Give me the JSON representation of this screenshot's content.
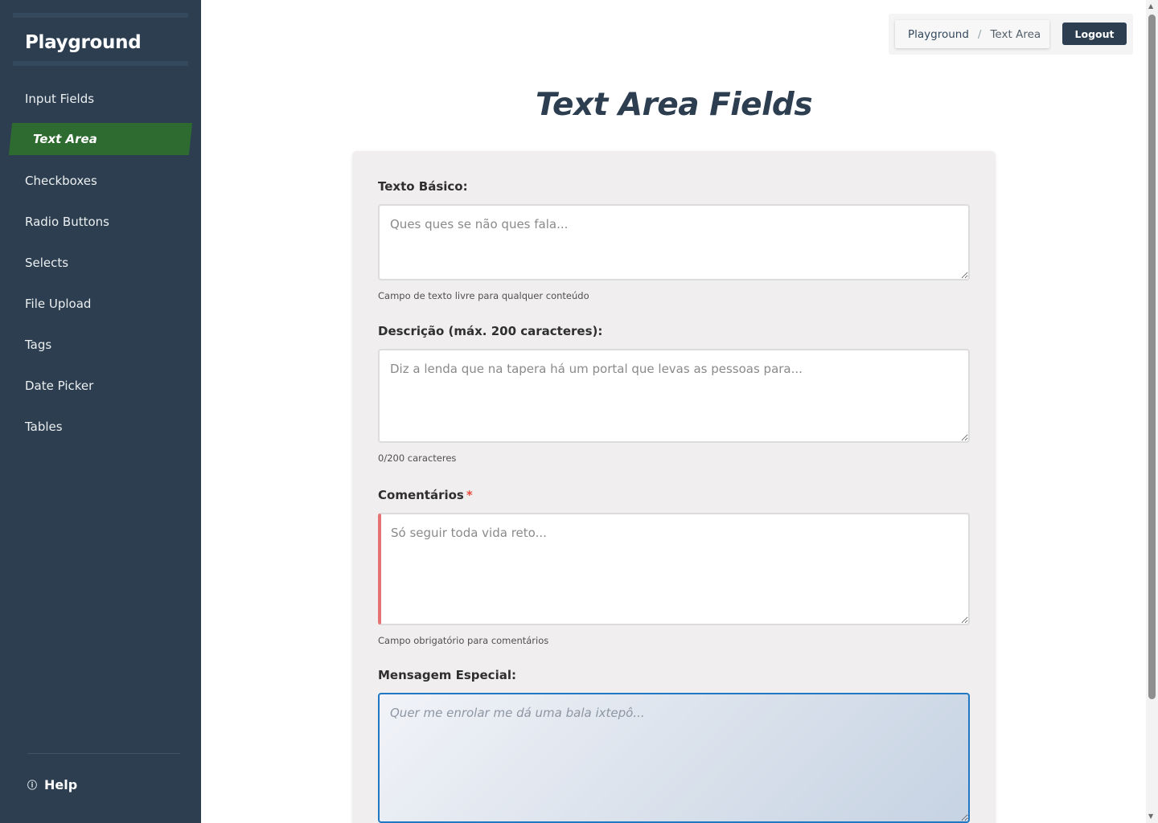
{
  "sidebar": {
    "brand": "Playground",
    "items": [
      {
        "label": "Input Fields"
      },
      {
        "label": "Text Area"
      },
      {
        "label": "Checkboxes"
      },
      {
        "label": "Radio Buttons"
      },
      {
        "label": "Selects"
      },
      {
        "label": "File Upload"
      },
      {
        "label": "Tags"
      },
      {
        "label": "Date Picker"
      },
      {
        "label": "Tables"
      }
    ],
    "active_item": "Text Area",
    "help": {
      "label": "Help",
      "icon": "info-icon"
    }
  },
  "header": {
    "breadcrumb": [
      "Playground",
      "/",
      "Text Area"
    ],
    "logout_label": "Logout"
  },
  "page": {
    "title": "Text Area Fields"
  },
  "form": {
    "fields": [
      {
        "label": "Texto Básico:",
        "placeholder": "Ques ques se não ques fala...",
        "value": "",
        "help": "Campo de texto livre para qualquer conteúdo"
      },
      {
        "label": "Descrição (máx. 200 caracteres):",
        "placeholder": "Diz a lenda que na tapera há um portal que levas as pessoas para...",
        "value": "",
        "help": "0/200 caracteres"
      },
      {
        "label": "Comentários",
        "required_marker": "*",
        "placeholder": "Só seguir toda vida reto...",
        "value": "",
        "help": "Campo obrigatório para comentários"
      },
      {
        "label": "Mensagem Especial:",
        "placeholder": "Quer me enrolar me dá uma bala ixtepô...",
        "value": ""
      }
    ]
  },
  "colors": {
    "sidebar_bg": "#2c3e50",
    "active_item_bg": "#2e6b30",
    "required_accent": "#e74c3c",
    "focus_border": "#1f78c1"
  }
}
